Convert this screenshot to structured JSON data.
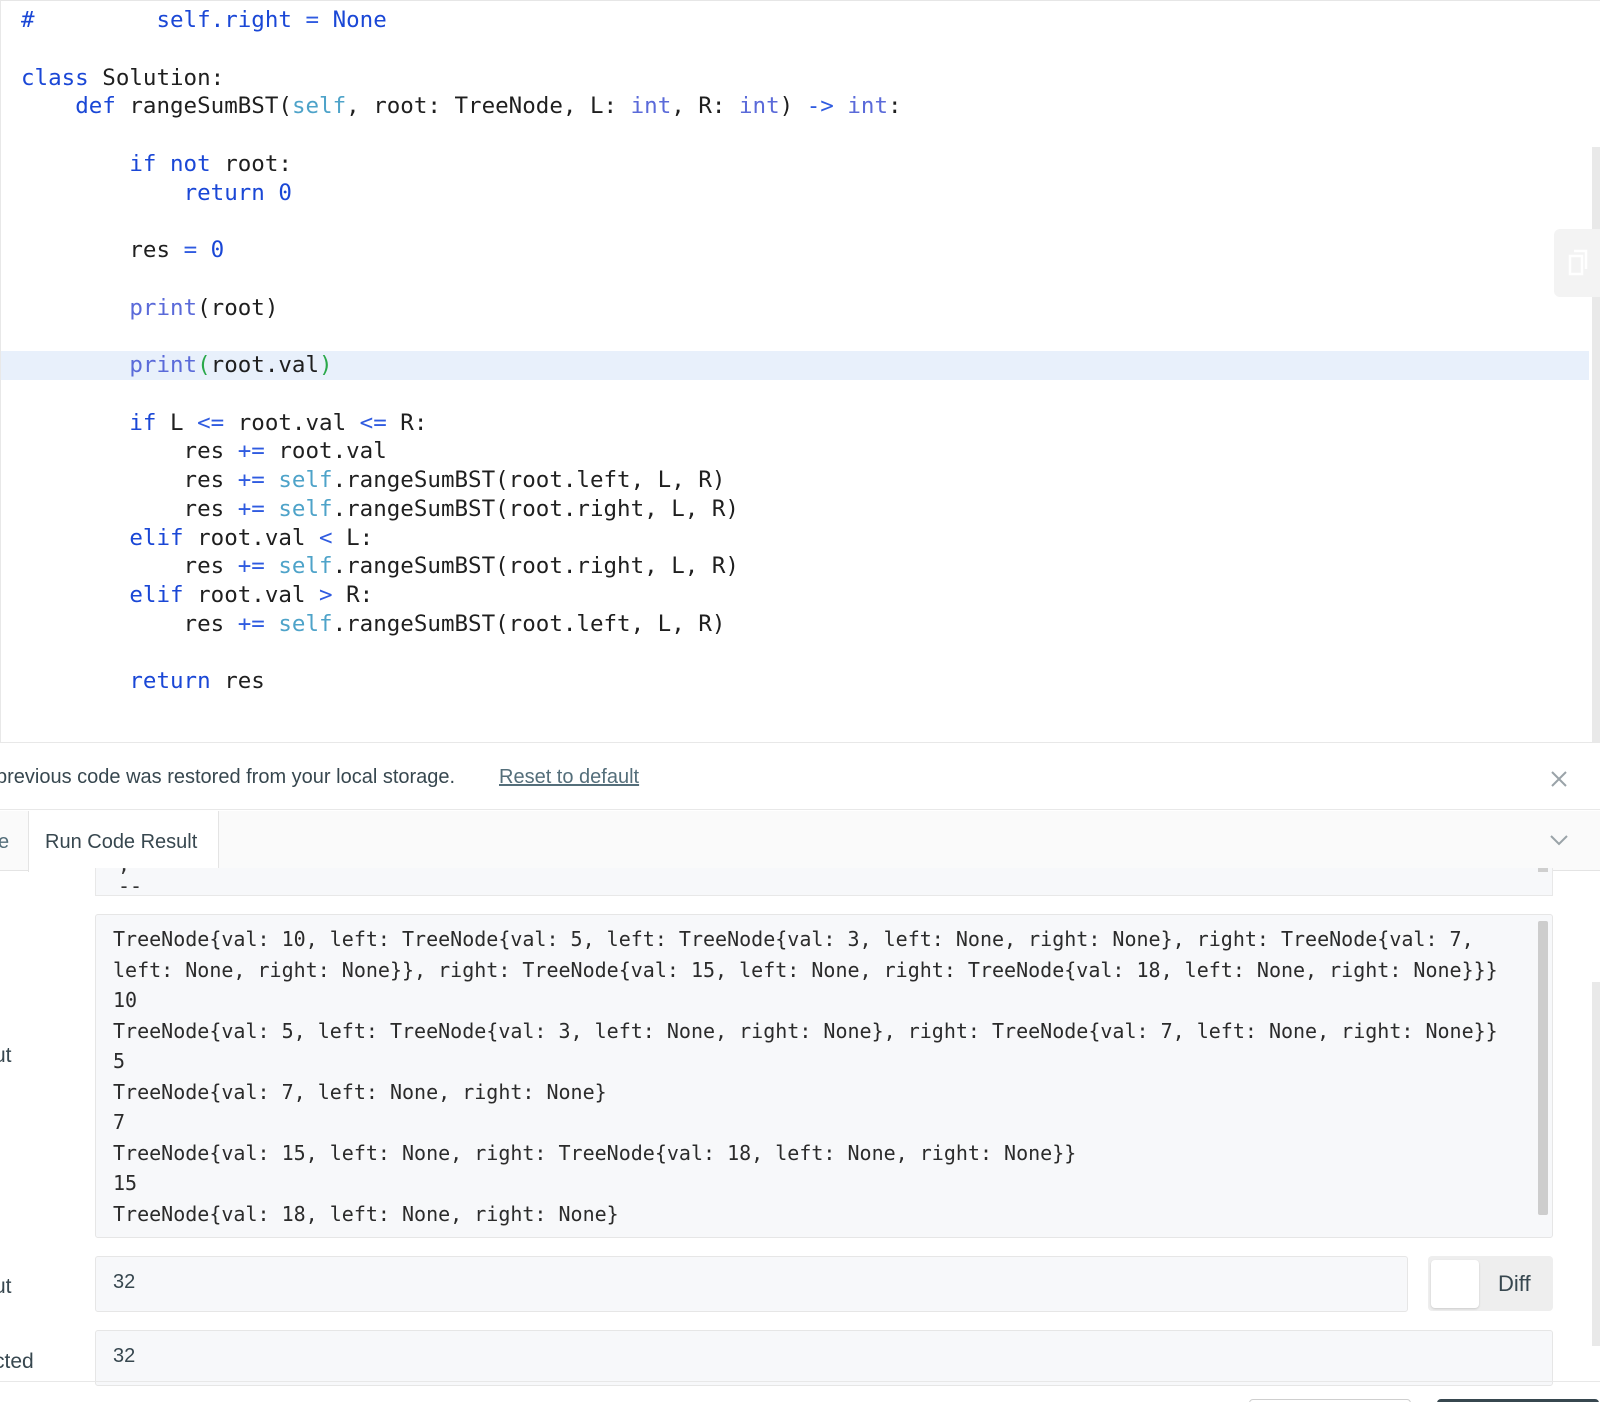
{
  "editor": {
    "lines": [
      "#         self.right = None",
      "",
      "class Solution:",
      "    def rangeSumBST(self, root: TreeNode, L: int, R: int) -> int:",
      "",
      "        if not root:",
      "            return 0",
      "",
      "        res = 0",
      "",
      "        print(root)",
      "",
      "        print(root.val)",
      "",
      "        if L <= root.val <= R:",
      "            res += root.val",
      "            res += self.rangeSumBST(root.left, L, R)",
      "            res += self.rangeSumBST(root.right, L, R)",
      "        elif root.val < L:",
      "            res += self.rangeSumBST(root.right, L, R)",
      "        elif root.val > R:",
      "            res += self.rangeSumBST(root.left, L, R)",
      "",
      "        return res"
    ],
    "active_line": 12
  },
  "notice": {
    "text": "previous code was restored from your local storage.",
    "reset_link": "Reset to default"
  },
  "tabs": {
    "previous_tab": "e",
    "active_tab": "Run Code Result"
  },
  "result": {
    "stdout_label": "ut",
    "stdout_lines": [
      "TreeNode{val: 10, left: TreeNode{val: 5, left: TreeNode{val: 3, left: None, right: None}, right: TreeNode{val: 7, left: None, right: None}}, right: TreeNode{val: 15, left: None, right: TreeNode{val: 18, left: None, right: None}}}",
      "10",
      "TreeNode{val: 5, left: TreeNode{val: 3, left: None, right: None}, right: TreeNode{val: 7, left: None, right: None}}",
      "5",
      "TreeNode{val: 7, left: None, right: None}",
      "7",
      "TreeNode{val: 15, left: None, right: TreeNode{val: 18, left: None, right: None}}",
      "15",
      "TreeNode{val: 18, left: None, right: None}"
    ],
    "output_label": "ut",
    "output_value": "32",
    "diff_label": "Diff",
    "expected_label": "cted",
    "expected_value": "32"
  },
  "icons": {
    "close": "close-icon",
    "collapse": "chevron-down-icon",
    "copy": "copy-icon"
  },
  "colors": {
    "keyword": "#1a47d6",
    "builtin": "#5a6ad9",
    "self": "#4ea3c9",
    "number": "#1d7a3a",
    "active_line": "#e8f0fb"
  }
}
